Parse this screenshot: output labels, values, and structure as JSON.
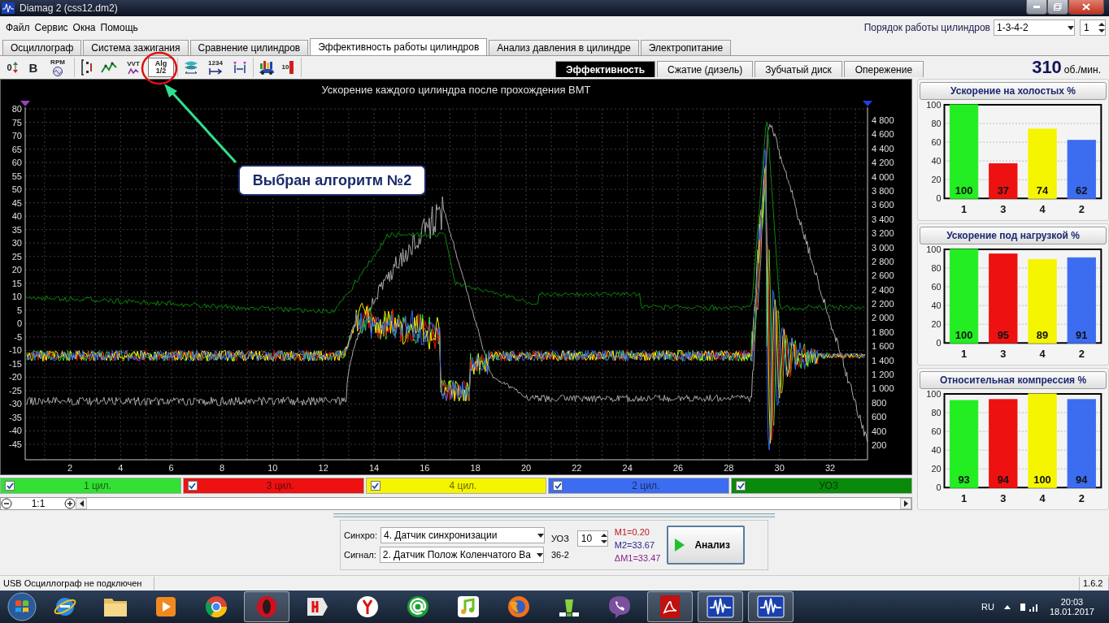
{
  "window": {
    "title": "Diamag 2 (css12.dm2)"
  },
  "menu": [
    "Файл",
    "Сервис",
    "Окна",
    "Помощь"
  ],
  "firing_order": {
    "label": "Порядок работы цилиндров",
    "value": "1-3-4-2",
    "spinner": "1"
  },
  "tabs": [
    {
      "label": "Осциллограф",
      "selected": false
    },
    {
      "label": "Система зажигания",
      "selected": false
    },
    {
      "label": "Сравнение цилиндров",
      "selected": false
    },
    {
      "label": "Эффективность работы цилиндров",
      "selected": true
    },
    {
      "label": "Анализ давления в цилиндре",
      "selected": false
    },
    {
      "label": "Электропитание",
      "selected": false
    }
  ],
  "toolbar_groups": [
    [
      {
        "kind": "step",
        "label": "0",
        "selected": false
      },
      {
        "kind": "bold",
        "label": "B",
        "selected": false
      },
      {
        "kind": "rpm",
        "label": "RPM",
        "selected": false
      }
    ],
    [
      {
        "kind": "scale",
        "selected": false
      },
      {
        "kind": "wave",
        "selected": false
      },
      {
        "kind": "vvt",
        "label": "VVT",
        "selected": false
      },
      {
        "kind": "alg",
        "label": "Alg 1/2",
        "selected": true
      }
    ],
    [
      {
        "kind": "layers",
        "selected": false
      },
      {
        "kind": "count",
        "label": "1234",
        "selected": false
      },
      {
        "kind": "markers",
        "selected": false
      }
    ],
    [
      {
        "kind": "bars",
        "selected": false
      },
      {
        "kind": "level",
        "label": "10",
        "selected": false
      }
    ]
  ],
  "subtabs": [
    {
      "label": "Эффективность",
      "selected": true
    },
    {
      "label": "Сжатие (дизель)",
      "selected": false
    },
    {
      "label": "Зубчатый диск",
      "selected": false
    },
    {
      "label": "Опережение",
      "selected": false
    }
  ],
  "rpm": {
    "value": "310",
    "unit": "об./мин."
  },
  "annotation": {
    "text": "Выбран алгоритм №2"
  },
  "oscillogram": {
    "title": "Ускорение каждого цилиндра после прохождения ВМТ",
    "left_ticks": [
      "80",
      "75",
      "70",
      "65",
      "60",
      "55",
      "50",
      "45",
      "40",
      "35",
      "30",
      "25",
      "20",
      "15",
      "10",
      "5",
      "0",
      "-5",
      "-10",
      "-15",
      "-20",
      "-25",
      "-30",
      "-35",
      "-40",
      "-45"
    ],
    "right_ticks": [
      "4 800",
      "4 600",
      "4 400",
      "4 200",
      "4 000",
      "3 800",
      "3 600",
      "3 400",
      "3 200",
      "3 000",
      "2 800",
      "2 600",
      "2 400",
      "2 200",
      "2 000",
      "1 800",
      "1 600",
      "1 400",
      "1 200",
      "1 000",
      "800",
      "600",
      "400",
      "200"
    ],
    "x_ticks": [
      "2",
      "4",
      "6",
      "8",
      "10",
      "12",
      "14",
      "16",
      "18",
      "20",
      "22",
      "24",
      "26",
      "28",
      "30",
      "32"
    ]
  },
  "channels": [
    {
      "kind": "cylinder",
      "label": "1 цил.",
      "checked": true,
      "color": "#33e033"
    },
    {
      "kind": "cylinder",
      "label": "3 цил.",
      "checked": true,
      "color": "#ee1111"
    },
    {
      "kind": "cylinder",
      "label": "4 цил.",
      "checked": true,
      "color": "#f5f500"
    },
    {
      "kind": "cylinder",
      "label": "2 цил.",
      "checked": true,
      "color": "#3c6cf0"
    },
    {
      "kind": "timing",
      "label": "УОЗ",
      "checked": true,
      "color": "#0a8a0a"
    }
  ],
  "zoom": {
    "value": "1:1"
  },
  "bar_charts": [
    {
      "title": "Ускорение на холостых %",
      "chart_data": {
        "type": "bar",
        "categories": [
          "1",
          "3",
          "4",
          "2"
        ],
        "stacked": true,
        "grid": true,
        "ylim": [
          0,
          100
        ],
        "yticks": [
          0,
          20,
          40,
          60,
          80,
          100
        ],
        "data_labels": true,
        "series": [
          {
            "color": "#22ee22",
            "values": [
              100,
              null,
              null,
              null
            ]
          },
          {
            "color": "#ee1111",
            "values": [
              null,
              37,
              null,
              null
            ]
          },
          {
            "color": "#f5f500",
            "values": [
              null,
              null,
              74,
              null
            ]
          },
          {
            "color": "#3c6cf0",
            "values": [
              null,
              null,
              null,
              62
            ]
          }
        ]
      }
    },
    {
      "title": "Ускорение под нагрузкой %",
      "chart_data": {
        "type": "bar",
        "categories": [
          "1",
          "3",
          "4",
          "2"
        ],
        "stacked": true,
        "grid": true,
        "ylim": [
          0,
          100
        ],
        "yticks": [
          0,
          20,
          40,
          60,
          80,
          100
        ],
        "data_labels": true,
        "series": [
          {
            "color": "#22ee22",
            "values": [
              100,
              null,
              null,
              null
            ]
          },
          {
            "color": "#ee1111",
            "values": [
              null,
              95,
              null,
              null
            ]
          },
          {
            "color": "#f5f500",
            "values": [
              null,
              null,
              89,
              null
            ]
          },
          {
            "color": "#3c6cf0",
            "values": [
              null,
              null,
              null,
              91
            ]
          }
        ]
      }
    },
    {
      "title": "Относительная компрессия %",
      "chart_data": {
        "type": "bar",
        "categories": [
          "1",
          "3",
          "4",
          "2"
        ],
        "stacked": true,
        "grid": true,
        "ylim": [
          0,
          100
        ],
        "yticks": [
          0,
          20,
          40,
          60,
          80,
          100
        ],
        "data_labels": true,
        "series": [
          {
            "color": "#22ee22",
            "values": [
              93,
              null,
              null,
              null
            ]
          },
          {
            "color": "#ee1111",
            "values": [
              null,
              94,
              null,
              null
            ]
          },
          {
            "color": "#f5f500",
            "values": [
              null,
              null,
              100,
              null
            ]
          },
          {
            "color": "#3c6cf0",
            "values": [
              null,
              null,
              null,
              94
            ]
          }
        ]
      }
    }
  ],
  "controls": {
    "sync_label": "Синхро:",
    "sync_value": "4.  Датчик синхронизации",
    "signal_label": "Сигнал:",
    "signal_value": "2.  Датчик Полож Коленчатого Ва",
    "uoz_label": "УОЗ",
    "uoz_value": "10",
    "wheel": "36-2",
    "readings": [
      {
        "text": "M1=0.20",
        "color": "#c0141e"
      },
      {
        "text": "M2=33.67",
        "color": "#1e1e8c"
      },
      {
        "text": "ΔM1=33.47",
        "color": "#8c1e8c"
      }
    ],
    "analyze_button": "Анализ"
  },
  "status_bar": {
    "message": "USB Осциллограф не подключен",
    "version": "1.6.2"
  },
  "taskbar": {
    "apps": [
      {
        "kind": "ie",
        "open": false
      },
      {
        "kind": "folder",
        "open": false
      },
      {
        "kind": "media",
        "open": false
      },
      {
        "kind": "chrome",
        "open": false
      },
      {
        "kind": "opera",
        "open": true
      },
      {
        "kind": "yandex",
        "open": false
      },
      {
        "kind": "yabrowser",
        "open": false
      },
      {
        "kind": "mail",
        "open": false
      },
      {
        "kind": "music",
        "open": false
      },
      {
        "kind": "firefox",
        "open": false
      },
      {
        "kind": "game",
        "open": false
      },
      {
        "kind": "viber",
        "open": false
      },
      {
        "kind": "pdf",
        "open": true
      },
      {
        "kind": "diamag",
        "open": true
      },
      {
        "kind": "diamag",
        "open": true
      }
    ],
    "language": "RU",
    "time": "20:03",
    "date": "18.01.2017"
  }
}
